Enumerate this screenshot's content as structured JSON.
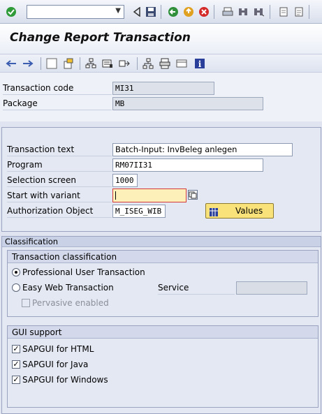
{
  "colors": {
    "accent_button": "#f9e27a",
    "required_field": "#fdf0b8",
    "required_border": "#d23a3a"
  },
  "toolbar": {
    "command_field_value": "",
    "icons": [
      "check-icon",
      "back-icon",
      "save-icon",
      "back-nav-icon",
      "exit-icon",
      "cancel-icon",
      "print-icon",
      "find-icon",
      "find-next-icon",
      "first-page-icon",
      "last-page-icon"
    ]
  },
  "title": "Change Report Transaction",
  "app_toolbar": {
    "icons": [
      "arrow-back-icon",
      "arrow-forward-icon",
      "display-change-icon",
      "other-object-icon",
      "where-used-icon",
      "object-list-icon",
      "navigation-icon",
      "hierarchy-icon",
      "print-layout-icon",
      "display-object-icon",
      "info-icon"
    ]
  },
  "header": {
    "tcode_label": "Transaction code",
    "tcode_value": "MI31",
    "package_label": "Package",
    "package_value": "MB"
  },
  "fields": {
    "transaction_text_label": "Transaction text",
    "transaction_text_value": "Batch-Input: InvBeleg anlegen",
    "program_label": "Program",
    "program_value": "RM07II31",
    "selection_screen_label": "Selection screen",
    "selection_screen_value": "1000",
    "start_variant_label": "Start with variant",
    "start_variant_value": "",
    "auth_object_label": "Authorization Object",
    "auth_object_value": "M_ISEG_WIB",
    "values_button_label": "Values"
  },
  "classification": {
    "panel_title": "Classification",
    "group_title": "Transaction classification",
    "professional_label": "Professional User Transaction",
    "easy_web_label": "Easy Web Transaction",
    "service_label": "Service",
    "service_value": "",
    "pervasive_label": "Pervasive enabled",
    "selected": "Professional User Transaction"
  },
  "gui_support": {
    "group_title": "GUI support",
    "html_label": "SAPGUI for HTML",
    "java_label": "SAPGUI for Java",
    "windows_label": "SAPGUI for Windows",
    "check_mark": "✓"
  }
}
